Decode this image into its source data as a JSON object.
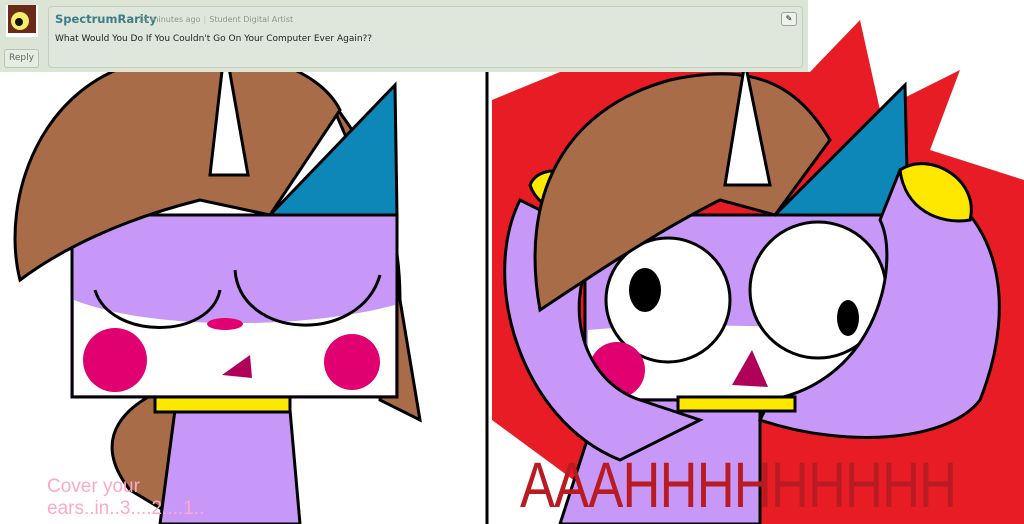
{
  "comment": {
    "username": "SpectrumRarity",
    "time": "14 minutes ago",
    "user_title": "Student Digital Artist",
    "text": "What Would You Do If You Couldn't Go On Your Computer Ever Again??",
    "reply_label": "Reply"
  },
  "artwork": {
    "caption_left": "Cover your ears..in..3....2....1..",
    "scream_text": "AAAHHHHHHHHH",
    "colors": {
      "hair": "#a86c48",
      "body": "#c898f8",
      "horn_hat": "#0d86b8",
      "cheek": "#e00070",
      "red": "#e81c24",
      "yellow": "#ffe800"
    }
  }
}
